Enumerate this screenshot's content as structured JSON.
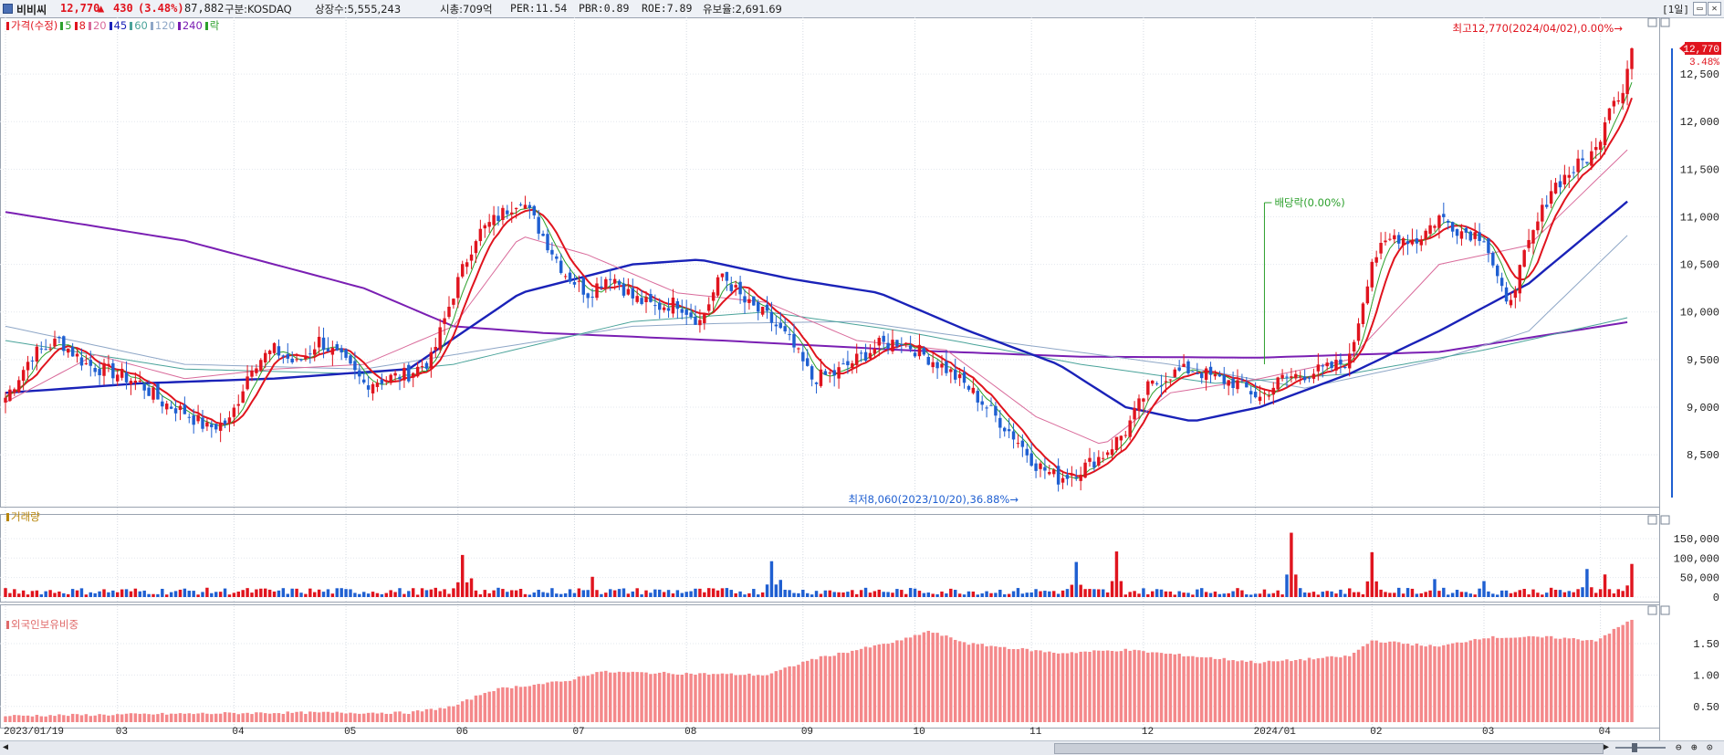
{
  "header": {
    "stock_name": "비비씨",
    "price": "12,770",
    "change_arrow": "▲",
    "change": "430",
    "change_pct": "(3.48%)",
    "volume": "87,882",
    "market": "구분:KOSDAQ",
    "listed_shares": "상장수:5,555,243",
    "market_cap": "시총:709억",
    "per": "PER:11.54",
    "pbr": "PBR:0.89",
    "roe": "ROE:7.89",
    "retention": "유보율:2,691.69",
    "period": "[1일]",
    "window_buttons": [
      "▭",
      "✕"
    ]
  },
  "colors": {
    "up": "#e0141e",
    "down": "#1f5fd1",
    "ma5": "#2ca02c",
    "ma8": "#e0141e",
    "ma20": "#d96b9b",
    "ma45": "#1a22b8",
    "ma60": "#4aa39a",
    "ma120": "#8fa7c7",
    "ma240": "#7a1fb3",
    "volume_label": "#b8860b",
    "foreign_label": "#e06a6a",
    "foreign_bar": "#f4888a"
  },
  "chart_data": [
    {
      "type": "candlestick",
      "panel": "price",
      "legend": [
        {
          "label": "가격(수정)",
          "color": "#e0141e"
        },
        {
          "label": "5",
          "color": "#2ca02c"
        },
        {
          "label": "8",
          "color": "#e0141e"
        },
        {
          "label": "20",
          "color": "#d96b9b"
        },
        {
          "label": "45",
          "color": "#1a22b8"
        },
        {
          "label": "60",
          "color": "#4aa39a"
        },
        {
          "label": "120",
          "color": "#8fa7c7"
        },
        {
          "label": "240",
          "color": "#7a1fb3"
        },
        {
          "label": "락",
          "color": "#2ca02c"
        }
      ],
      "ylim": [
        8050,
        13000
      ],
      "yticks": [
        "12,500",
        "12,000",
        "11,500",
        "11,000",
        "10,500",
        "10,000",
        "9,500",
        "9,000",
        "8,500"
      ],
      "ytick_values": [
        12500,
        12000,
        11500,
        11000,
        10500,
        10000,
        9500,
        9000,
        8500
      ],
      "x_labels": [
        "2023/01/19",
        "03",
        "04",
        "05",
        "06",
        "07",
        "08",
        "09",
        "10",
        "11",
        "12",
        "2024/01",
        "02",
        "03",
        "04"
      ],
      "x_label_index": [
        0,
        25,
        51,
        76,
        101,
        127,
        152,
        178,
        203,
        229,
        254,
        279,
        305,
        330,
        356
      ],
      "close_keypoints": [
        [
          0,
          9100
        ],
        [
          6,
          9550
        ],
        [
          12,
          9700
        ],
        [
          18,
          9450
        ],
        [
          25,
          9350
        ],
        [
          30,
          9250
        ],
        [
          35,
          9050
        ],
        [
          40,
          8950
        ],
        [
          45,
          8780
        ],
        [
          50,
          8850
        ],
        [
          55,
          9450
        ],
        [
          60,
          9600
        ],
        [
          65,
          9450
        ],
        [
          70,
          9700
        ],
        [
          75,
          9500
        ],
        [
          80,
          9250
        ],
        [
          85,
          9300
        ],
        [
          90,
          9350
        ],
        [
          95,
          9500
        ],
        [
          100,
          10200
        ],
        [
          105,
          10800
        ],
        [
          110,
          11000
        ],
        [
          115,
          11200
        ],
        [
          120,
          10800
        ],
        [
          125,
          10400
        ],
        [
          130,
          10200
        ],
        [
          135,
          10400
        ],
        [
          140,
          10150
        ],
        [
          145,
          10050
        ],
        [
          150,
          10100
        ],
        [
          155,
          9900
        ],
        [
          160,
          10400
        ],
        [
          165,
          10100
        ],
        [
          170,
          9950
        ],
        [
          175,
          9700
        ],
        [
          180,
          9300
        ],
        [
          185,
          9350
        ],
        [
          190,
          9500
        ],
        [
          195,
          9650
        ],
        [
          200,
          9700
        ],
        [
          205,
          9550
        ],
        [
          210,
          9400
        ],
        [
          215,
          9200
        ],
        [
          220,
          8950
        ],
        [
          225,
          8700
        ],
        [
          230,
          8400
        ],
        [
          235,
          8250
        ],
        [
          240,
          8350
        ],
        [
          245,
          8500
        ],
        [
          250,
          8750
        ],
        [
          255,
          9200
        ],
        [
          260,
          9350
        ],
        [
          265,
          9400
        ],
        [
          270,
          9300
        ],
        [
          275,
          9250
        ],
        [
          280,
          9100
        ],
        [
          285,
          9300
        ],
        [
          290,
          9350
        ],
        [
          295,
          9400
        ],
        [
          300,
          9500
        ],
        [
          305,
          10550
        ],
        [
          310,
          10800
        ],
        [
          315,
          10750
        ],
        [
          320,
          11000
        ],
        [
          325,
          10850
        ],
        [
          330,
          10800
        ],
        [
          335,
          10050
        ],
        [
          340,
          10700
        ],
        [
          345,
          11300
        ],
        [
          350,
          11500
        ],
        [
          355,
          11700
        ],
        [
          358,
          12200
        ],
        [
          361,
          12340
        ],
        [
          363,
          12770
        ]
      ],
      "moving_averages": [
        {
          "period": 240,
          "points": [
            [
              0,
              11050
            ],
            [
              40,
              10750
            ],
            [
              80,
              10250
            ],
            [
              100,
              9850
            ],
            [
              120,
              9780
            ],
            [
              160,
              9700
            ],
            [
              200,
              9600
            ],
            [
              240,
              9530
            ],
            [
              280,
              9520
            ],
            [
              320,
              9580
            ],
            [
              363,
              9900
            ]
          ]
        },
        {
          "period": 120,
          "points": [
            [
              0,
              9850
            ],
            [
              40,
              9450
            ],
            [
              80,
              9400
            ],
            [
              100,
              9550
            ],
            [
              140,
              9850
            ],
            [
              160,
              9880
            ],
            [
              190,
              9900
            ],
            [
              220,
              9700
            ],
            [
              260,
              9450
            ],
            [
              290,
              9200
            ],
            [
              320,
              9500
            ],
            [
              340,
              9800
            ],
            [
              363,
              10850
            ]
          ]
        },
        {
          "period": 60,
          "points": [
            [
              0,
              9700
            ],
            [
              40,
              9400
            ],
            [
              80,
              9350
            ],
            [
              100,
              9450
            ],
            [
              140,
              9900
            ],
            [
              170,
              10000
            ],
            [
              200,
              9800
            ],
            [
              240,
              9450
            ],
            [
              270,
              9250
            ],
            [
              300,
              9350
            ],
            [
              330,
              9600
            ],
            [
              363,
              9950
            ]
          ]
        },
        {
          "period": 45,
          "points": [
            [
              0,
              9150
            ],
            [
              30,
              9250
            ],
            [
              60,
              9300
            ],
            [
              90,
              9400
            ],
            [
              115,
              10200
            ],
            [
              140,
              10500
            ],
            [
              155,
              10550
            ],
            [
              175,
              10350
            ],
            [
              195,
              10200
            ],
            [
              215,
              9800
            ],
            [
              235,
              9450
            ],
            [
              250,
              9000
            ],
            [
              265,
              8850
            ],
            [
              280,
              9000
            ],
            [
              300,
              9350
            ],
            [
              320,
              9800
            ],
            [
              340,
              10300
            ],
            [
              363,
              11200
            ]
          ]
        },
        {
          "period": 20,
          "points": [
            [
              0,
              9050
            ],
            [
              20,
              9550
            ],
            [
              40,
              9300
            ],
            [
              60,
              9400
            ],
            [
              80,
              9450
            ],
            [
              100,
              9850
            ],
            [
              115,
              10800
            ],
            [
              130,
              10600
            ],
            [
              150,
              10200
            ],
            [
              170,
              10100
            ],
            [
              190,
              9700
            ],
            [
              210,
              9600
            ],
            [
              230,
              8900
            ],
            [
              245,
              8600
            ],
            [
              260,
              9150
            ],
            [
              280,
              9300
            ],
            [
              300,
              9500
            ],
            [
              320,
              10500
            ],
            [
              340,
              10700
            ],
            [
              363,
              11750
            ]
          ]
        }
      ],
      "annotations": [
        {
          "text": "최고12,770(2024/04/02),0.00%→",
          "color": "#e0141e"
        },
        {
          "text": "최저8,060(2023/10/20),36.88%→",
          "color": "#1f5fd1"
        },
        {
          "text": "배당락(0.00%)",
          "color": "#2ca02c"
        }
      ],
      "last_price_tag": "12,770",
      "last_pct_tag": "3.48%"
    },
    {
      "type": "bar",
      "panel": "volume",
      "legend": [
        {
          "label": "거래량",
          "color": "#b8860b"
        }
      ],
      "ylim": [
        0,
        185000
      ],
      "yticks": [
        "150,000",
        "100,000",
        "50,000",
        "0"
      ],
      "ytick_values": [
        150000,
        100000,
        50000,
        0
      ],
      "spikes": [
        [
          102,
          108000
        ],
        [
          104,
          48000
        ],
        [
          131,
          52000
        ],
        [
          171,
          92000
        ],
        [
          173,
          44000
        ],
        [
          239,
          90000
        ],
        [
          248,
          117000
        ],
        [
          287,
          165000
        ],
        [
          305,
          115000
        ],
        [
          319,
          46000
        ],
        [
          330,
          41000
        ],
        [
          353,
          72000
        ],
        [
          357,
          58000
        ],
        [
          363,
          85000
        ]
      ]
    },
    {
      "type": "bar",
      "panel": "foreign_ownership",
      "legend": [
        {
          "label": "외국인보유비중",
          "color": "#e06a6a"
        }
      ],
      "ylim": [
        0.25,
        1.95
      ],
      "yticks": [
        "1.50",
        "1.00",
        "0.50"
      ],
      "ytick_values": [
        1.5,
        1.0,
        0.5
      ],
      "level_keypoints": [
        [
          0,
          0.35
        ],
        [
          60,
          0.4
        ],
        [
          90,
          0.4
        ],
        [
          100,
          0.5
        ],
        [
          108,
          0.75
        ],
        [
          112,
          0.8
        ],
        [
          125,
          0.9
        ],
        [
          132,
          1.05
        ],
        [
          170,
          1.0
        ],
        [
          180,
          1.25
        ],
        [
          200,
          1.55
        ],
        [
          206,
          1.7
        ],
        [
          215,
          1.5
        ],
        [
          235,
          1.35
        ],
        [
          250,
          1.4
        ],
        [
          265,
          1.3
        ],
        [
          280,
          1.2
        ],
        [
          300,
          1.3
        ],
        [
          305,
          1.55
        ],
        [
          320,
          1.45
        ],
        [
          330,
          1.6
        ],
        [
          345,
          1.6
        ],
        [
          355,
          1.55
        ],
        [
          363,
          1.88
        ]
      ]
    }
  ]
}
